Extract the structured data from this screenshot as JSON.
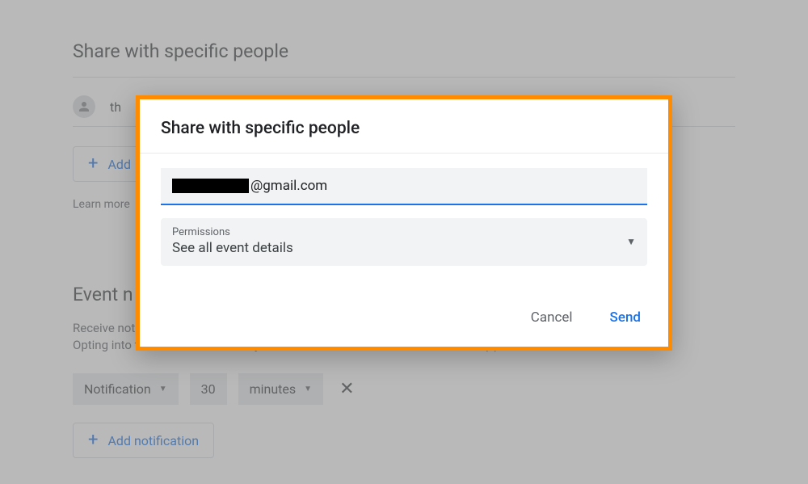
{
  "share_section": {
    "title": "Share with specific people",
    "person_prefix": "th",
    "add_button": "Add",
    "learn_more": "Learn more"
  },
  "event_section": {
    "title": "Event n",
    "desc_line1": "Receive notifications for events on this calendar.",
    "desc_line2": "Opting into these notifications may alert and be visible to the calendar owner(s)",
    "notification_type": "Notification",
    "notification_value": "30",
    "notification_unit": "minutes",
    "add_notification": "Add notification"
  },
  "dialog": {
    "title": "Share with specific people",
    "email_suffix": "@gmail.com",
    "permissions_label": "Permissions",
    "permissions_value": "See all event details",
    "cancel": "Cancel",
    "send": "Send"
  }
}
